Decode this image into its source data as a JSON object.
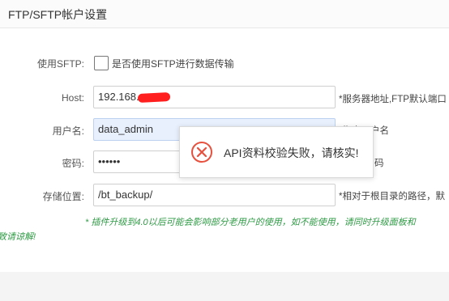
{
  "header": {
    "title": "FTP/SFTP帐户设置"
  },
  "form": {
    "sftp": {
      "label": "使用SFTP:",
      "checkbox_label": "是否使用SFTP进行数据传输",
      "checked": false
    },
    "host": {
      "label": "Host:",
      "value_visible": "192.168.",
      "help": "*服务器地址,FTP默认端口"
    },
    "username": {
      "label": "用户名:",
      "value": "data_admin",
      "help_visible": "*指定用户名"
    },
    "password": {
      "label": "密码:",
      "value": "••••••",
      "help_visible": "码"
    },
    "storage": {
      "label": "存储位置:",
      "value": "/bt_backup/",
      "help": "*相对于根目录的路径，默"
    }
  },
  "notice": {
    "line1": "* 插件升级到4.0以后可能会影响部分老用户的使用，如不能使用，请同时升级面板和",
    "line2": "致请谅解!"
  },
  "toast": {
    "message": "API资料校验失败，请核实!",
    "icon": "error-circle-x-icon",
    "icon_color": "#e8503e"
  },
  "colors": {
    "notice": "#2f9b45",
    "redaction": "#ff1f1f",
    "autofill_background": "#e8f0fe"
  }
}
